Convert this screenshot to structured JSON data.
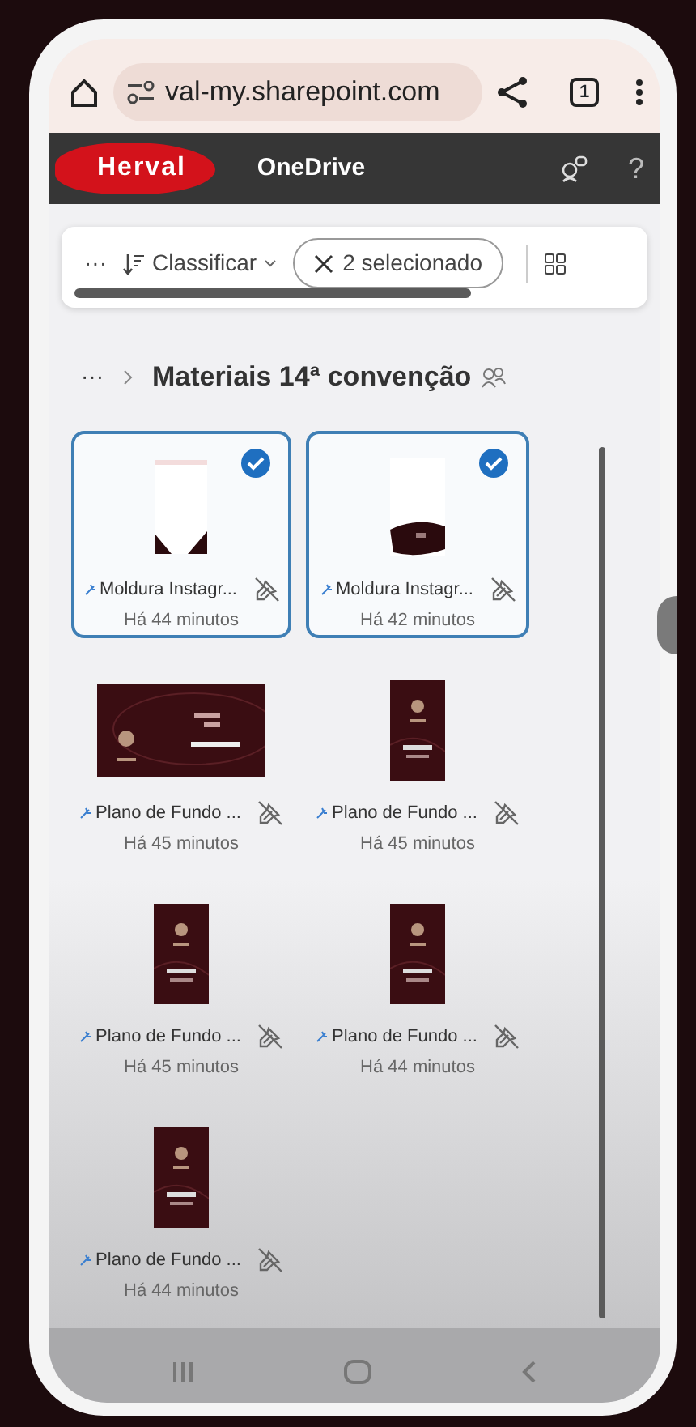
{
  "browser": {
    "url": "val-my.sharepoint.com",
    "tab_count": "1"
  },
  "header": {
    "logo": "Herval",
    "app": "OneDrive",
    "help": "?"
  },
  "command_bar": {
    "more": "···",
    "sort": "Classificar",
    "selection": "2 selecionado"
  },
  "breadcrumb": {
    "more": "···",
    "title": "Materiais 14ª convenção"
  },
  "files": [
    {
      "name": "Moldura Instagr...",
      "time": "Há 44 minutos",
      "selected": true,
      "kind": "frame"
    },
    {
      "name": "Moldura Instagr...",
      "time": "Há 42 minutos",
      "selected": true,
      "kind": "badge"
    },
    {
      "name": "Plano de Fundo ...",
      "time": "Há 45 minutos",
      "selected": false,
      "kind": "banner"
    },
    {
      "name": "Plano de Fundo ...",
      "time": "Há 45 minutos",
      "selected": false,
      "kind": "poster"
    },
    {
      "name": "Plano de Fundo ...",
      "time": "Há 45 minutos",
      "selected": false,
      "kind": "poster"
    },
    {
      "name": "Plano de Fundo ...",
      "time": "Há 44 minutos",
      "selected": false,
      "kind": "poster"
    },
    {
      "name": "Plano de Fundo ...",
      "time": "Há 44 minutos",
      "selected": false,
      "kind": "poster"
    }
  ]
}
